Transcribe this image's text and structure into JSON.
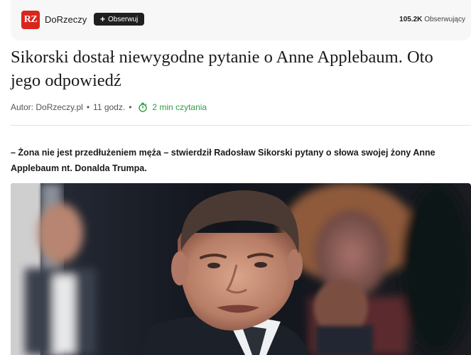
{
  "topbar": {
    "logo_text": "RZ",
    "brand_name": "DoRzeczy",
    "follow_label": "Obserwuj",
    "followers_count": "105.2K",
    "followers_label": "Obserwujący"
  },
  "article": {
    "title": "Sikorski dostał niewygodne pytanie o Anne Applebaum. Oto jego odpowiedź",
    "author_label": "Autor:",
    "author": "DoRzeczy.pl",
    "time_ago": "11 godz.",
    "read_time": "2 min czytania",
    "lead": "– Żona nie jest przedłużeniem męża – stwierdził Radosław Sikorski pytany o słowa swojej żony Anne Applebaum nt. Donalda Trumpa."
  },
  "colors": {
    "brand_red": "#d9261c",
    "read_time_green": "#2f9e44",
    "button_dark": "#1f1f1f"
  },
  "icons": {
    "follow": "plus-icon",
    "read_time": "stopwatch-icon"
  }
}
